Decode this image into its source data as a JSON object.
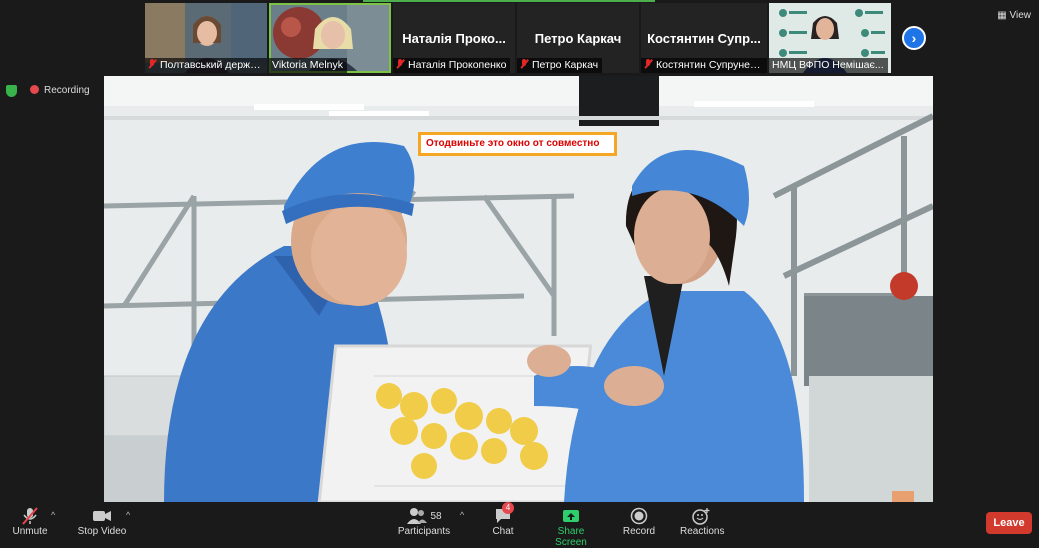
{
  "participants_strip": [
    {
      "name": "Полтавський держав...",
      "muted": true,
      "type": "video"
    },
    {
      "name": "Viktoria Melnyk",
      "muted": false,
      "type": "video",
      "active": true
    },
    {
      "name": "Наталія Прокопенко",
      "display": "Наталія Проко...",
      "muted": true,
      "type": "name"
    },
    {
      "name": "Петро Каркач",
      "display": "Петро Каркач",
      "muted": true,
      "type": "name"
    },
    {
      "name": "Костянтин Супруненко",
      "display": "Костянтин Супр...",
      "muted": true,
      "type": "name"
    },
    {
      "name": "НМЦ ВФПО Немішає...",
      "muted": false,
      "type": "video"
    }
  ],
  "view_label": "View",
  "recording_label": "Recording",
  "share_warning": "Отодвиньте это окно от совместно",
  "toolbar": {
    "unmute": "Unmute",
    "stop_video": "Stop Video",
    "participants": "Participants",
    "participants_count": "58",
    "chat": "Chat",
    "chat_badge": "4",
    "share_screen": "Share Screen",
    "record": "Record",
    "reactions": "Reactions",
    "leave": "Leave"
  },
  "colors": {
    "share_green": "#2fce6c",
    "leave_red": "#d23a2e",
    "accent_blue": "#1f74e8"
  }
}
